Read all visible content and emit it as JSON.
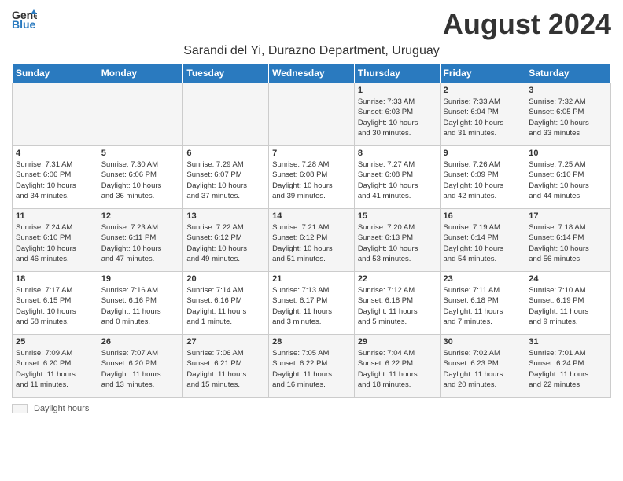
{
  "header": {
    "logo_general": "General",
    "logo_blue": "Blue",
    "month_title": "August 2024",
    "location": "Sarandi del Yi, Durazno Department, Uruguay"
  },
  "weekdays": [
    "Sunday",
    "Monday",
    "Tuesday",
    "Wednesday",
    "Thursday",
    "Friday",
    "Saturday"
  ],
  "weeks": [
    [
      {
        "day": "",
        "info": ""
      },
      {
        "day": "",
        "info": ""
      },
      {
        "day": "",
        "info": ""
      },
      {
        "day": "",
        "info": ""
      },
      {
        "day": "1",
        "info": "Sunrise: 7:33 AM\nSunset: 6:03 PM\nDaylight: 10 hours\nand 30 minutes."
      },
      {
        "day": "2",
        "info": "Sunrise: 7:33 AM\nSunset: 6:04 PM\nDaylight: 10 hours\nand 31 minutes."
      },
      {
        "day": "3",
        "info": "Sunrise: 7:32 AM\nSunset: 6:05 PM\nDaylight: 10 hours\nand 33 minutes."
      }
    ],
    [
      {
        "day": "4",
        "info": "Sunrise: 7:31 AM\nSunset: 6:06 PM\nDaylight: 10 hours\nand 34 minutes."
      },
      {
        "day": "5",
        "info": "Sunrise: 7:30 AM\nSunset: 6:06 PM\nDaylight: 10 hours\nand 36 minutes."
      },
      {
        "day": "6",
        "info": "Sunrise: 7:29 AM\nSunset: 6:07 PM\nDaylight: 10 hours\nand 37 minutes."
      },
      {
        "day": "7",
        "info": "Sunrise: 7:28 AM\nSunset: 6:08 PM\nDaylight: 10 hours\nand 39 minutes."
      },
      {
        "day": "8",
        "info": "Sunrise: 7:27 AM\nSunset: 6:08 PM\nDaylight: 10 hours\nand 41 minutes."
      },
      {
        "day": "9",
        "info": "Sunrise: 7:26 AM\nSunset: 6:09 PM\nDaylight: 10 hours\nand 42 minutes."
      },
      {
        "day": "10",
        "info": "Sunrise: 7:25 AM\nSunset: 6:10 PM\nDaylight: 10 hours\nand 44 minutes."
      }
    ],
    [
      {
        "day": "11",
        "info": "Sunrise: 7:24 AM\nSunset: 6:10 PM\nDaylight: 10 hours\nand 46 minutes."
      },
      {
        "day": "12",
        "info": "Sunrise: 7:23 AM\nSunset: 6:11 PM\nDaylight: 10 hours\nand 47 minutes."
      },
      {
        "day": "13",
        "info": "Sunrise: 7:22 AM\nSunset: 6:12 PM\nDaylight: 10 hours\nand 49 minutes."
      },
      {
        "day": "14",
        "info": "Sunrise: 7:21 AM\nSunset: 6:12 PM\nDaylight: 10 hours\nand 51 minutes."
      },
      {
        "day": "15",
        "info": "Sunrise: 7:20 AM\nSunset: 6:13 PM\nDaylight: 10 hours\nand 53 minutes."
      },
      {
        "day": "16",
        "info": "Sunrise: 7:19 AM\nSunset: 6:14 PM\nDaylight: 10 hours\nand 54 minutes."
      },
      {
        "day": "17",
        "info": "Sunrise: 7:18 AM\nSunset: 6:14 PM\nDaylight: 10 hours\nand 56 minutes."
      }
    ],
    [
      {
        "day": "18",
        "info": "Sunrise: 7:17 AM\nSunset: 6:15 PM\nDaylight: 10 hours\nand 58 minutes."
      },
      {
        "day": "19",
        "info": "Sunrise: 7:16 AM\nSunset: 6:16 PM\nDaylight: 11 hours\nand 0 minutes."
      },
      {
        "day": "20",
        "info": "Sunrise: 7:14 AM\nSunset: 6:16 PM\nDaylight: 11 hours\nand 1 minute."
      },
      {
        "day": "21",
        "info": "Sunrise: 7:13 AM\nSunset: 6:17 PM\nDaylight: 11 hours\nand 3 minutes."
      },
      {
        "day": "22",
        "info": "Sunrise: 7:12 AM\nSunset: 6:18 PM\nDaylight: 11 hours\nand 5 minutes."
      },
      {
        "day": "23",
        "info": "Sunrise: 7:11 AM\nSunset: 6:18 PM\nDaylight: 11 hours\nand 7 minutes."
      },
      {
        "day": "24",
        "info": "Sunrise: 7:10 AM\nSunset: 6:19 PM\nDaylight: 11 hours\nand 9 minutes."
      }
    ],
    [
      {
        "day": "25",
        "info": "Sunrise: 7:09 AM\nSunset: 6:20 PM\nDaylight: 11 hours\nand 11 minutes."
      },
      {
        "day": "26",
        "info": "Sunrise: 7:07 AM\nSunset: 6:20 PM\nDaylight: 11 hours\nand 13 minutes."
      },
      {
        "day": "27",
        "info": "Sunrise: 7:06 AM\nSunset: 6:21 PM\nDaylight: 11 hours\nand 15 minutes."
      },
      {
        "day": "28",
        "info": "Sunrise: 7:05 AM\nSunset: 6:22 PM\nDaylight: 11 hours\nand 16 minutes."
      },
      {
        "day": "29",
        "info": "Sunrise: 7:04 AM\nSunset: 6:22 PM\nDaylight: 11 hours\nand 18 minutes."
      },
      {
        "day": "30",
        "info": "Sunrise: 7:02 AM\nSunset: 6:23 PM\nDaylight: 11 hours\nand 20 minutes."
      },
      {
        "day": "31",
        "info": "Sunrise: 7:01 AM\nSunset: 6:24 PM\nDaylight: 11 hours\nand 22 minutes."
      }
    ]
  ],
  "footer": {
    "legend_label": "Daylight hours"
  }
}
